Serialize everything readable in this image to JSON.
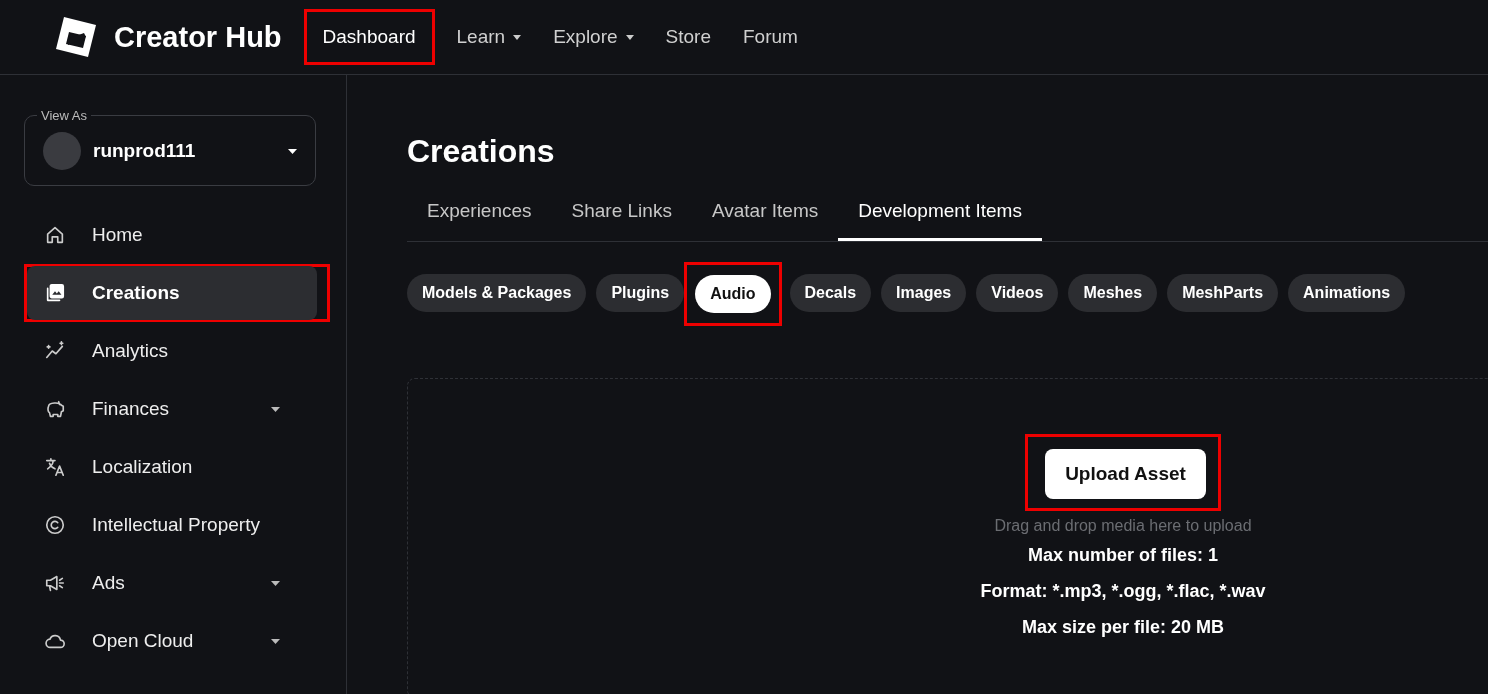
{
  "header": {
    "logo_text": "Creator Hub",
    "nav": [
      {
        "label": "Dashboard",
        "dropdown": false,
        "highlighted": true
      },
      {
        "label": "Learn",
        "dropdown": true,
        "highlighted": false
      },
      {
        "label": "Explore",
        "dropdown": true,
        "highlighted": false
      },
      {
        "label": "Store",
        "dropdown": false,
        "highlighted": false
      },
      {
        "label": "Forum",
        "dropdown": false,
        "highlighted": false
      }
    ]
  },
  "sidebar": {
    "view_as": {
      "label": "View As",
      "username": "runprod111"
    },
    "items": [
      {
        "label": "Home",
        "selected": false,
        "dropdown": false,
        "highlighted": false
      },
      {
        "label": "Creations",
        "selected": true,
        "dropdown": false,
        "highlighted": true
      },
      {
        "label": "Analytics",
        "selected": false,
        "dropdown": false,
        "highlighted": false
      },
      {
        "label": "Finances",
        "selected": false,
        "dropdown": true,
        "highlighted": false
      },
      {
        "label": "Localization",
        "selected": false,
        "dropdown": false,
        "highlighted": false
      },
      {
        "label": "Intellectual Property",
        "selected": false,
        "dropdown": false,
        "highlighted": false
      },
      {
        "label": "Ads",
        "selected": false,
        "dropdown": true,
        "highlighted": false
      },
      {
        "label": "Open Cloud",
        "selected": false,
        "dropdown": true,
        "highlighted": false
      }
    ]
  },
  "main": {
    "title": "Creations",
    "tabs": [
      {
        "label": "Experiences",
        "selected": false
      },
      {
        "label": "Share Links",
        "selected": false
      },
      {
        "label": "Avatar Items",
        "selected": false
      },
      {
        "label": "Development Items",
        "selected": true
      }
    ],
    "chips": [
      {
        "label": "Models & Packages",
        "selected": false,
        "highlighted": false
      },
      {
        "label": "Plugins",
        "selected": false,
        "highlighted": false
      },
      {
        "label": "Audio",
        "selected": true,
        "highlighted": true
      },
      {
        "label": "Decals",
        "selected": false,
        "highlighted": false
      },
      {
        "label": "Images",
        "selected": false,
        "highlighted": false
      },
      {
        "label": "Videos",
        "selected": false,
        "highlighted": false
      },
      {
        "label": "Meshes",
        "selected": false,
        "highlighted": false
      },
      {
        "label": "MeshParts",
        "selected": false,
        "highlighted": false
      },
      {
        "label": "Animations",
        "selected": false,
        "highlighted": false
      }
    ],
    "upload": {
      "button": "Upload Asset",
      "highlighted": true,
      "hint": "Drag and drop media here to upload",
      "rules": [
        "Max number of files: 1",
        "Format: *.mp3, *.ogg, *.flac, *.wav",
        "Max size per file: 20 MB"
      ]
    }
  }
}
